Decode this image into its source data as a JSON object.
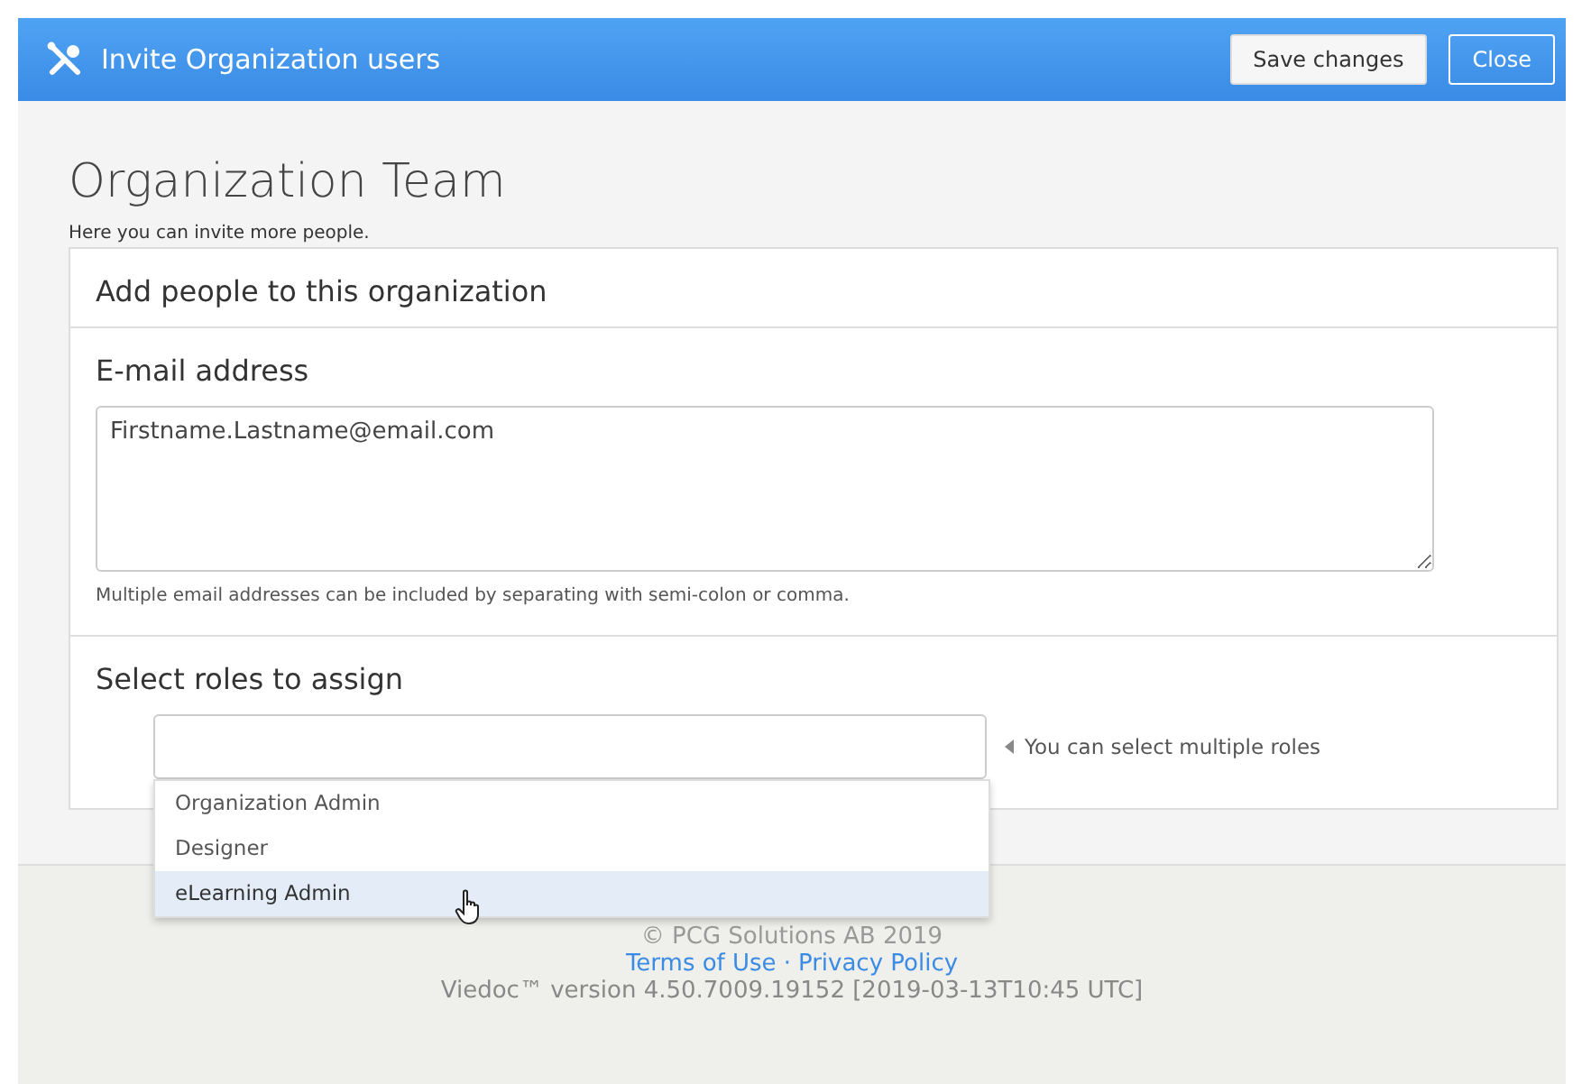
{
  "header": {
    "title": "Invite Organization users",
    "buttons": [
      {
        "label": "Save changes",
        "kind": "secondary"
      },
      {
        "label": "Close",
        "kind": "outline"
      }
    ]
  },
  "page": {
    "title": "Organization Team",
    "subtitle": "Here you can invite more people."
  },
  "card": {
    "title": "Add people to this organization",
    "email": {
      "label": "E-mail address",
      "value": "Firstname.Lastname@email.com",
      "help": "Multiple email addresses can be included by separating with semi-colon or comma."
    },
    "roles": {
      "label": "Select roles to assign",
      "hint": "You can select multiple roles",
      "options": [
        {
          "label": "Organization Admin",
          "selected": false
        },
        {
          "label": "Designer",
          "selected": false
        },
        {
          "label": "eLearning Admin",
          "selected": true
        }
      ]
    }
  },
  "footer": {
    "copyright": "© PCG Solutions AB 2019",
    "links": [
      "Terms of Use",
      "Privacy Policy"
    ],
    "separator": "·",
    "version": "Viedoc™ version 4.50.7009.19152 [2019-03-13T10:45 UTC]"
  }
}
